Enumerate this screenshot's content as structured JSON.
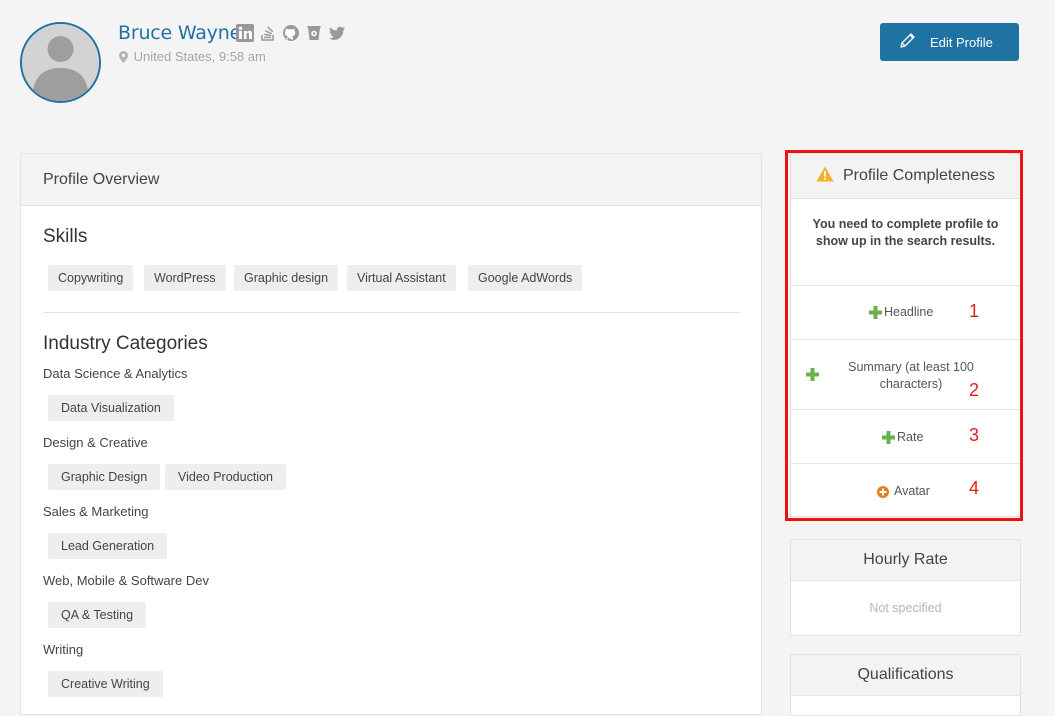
{
  "profile": {
    "name": "Bruce Wayne",
    "location": "United States, 9:58 am",
    "social_icons": [
      "linkedin-icon",
      "stackoverflow-icon",
      "github-icon",
      "coffee-icon",
      "twitter-icon"
    ],
    "edit_label": "Edit Profile"
  },
  "overview": {
    "title": "Profile Overview",
    "skills_title": "Skills",
    "skills": [
      "Copywriting",
      "WordPress",
      "Graphic design",
      "Virtual Assistant",
      "Google AdWords"
    ],
    "industry_title": "Industry Categories",
    "categories": [
      {
        "name": "Data Science & Analytics",
        "items": [
          "Data Visualization"
        ]
      },
      {
        "name": "Design & Creative",
        "items": [
          "Graphic Design",
          "Video Production"
        ]
      },
      {
        "name": "Sales & Marketing",
        "items": [
          "Lead Generation"
        ]
      },
      {
        "name": "Web, Mobile & Software Dev",
        "items": [
          "QA & Testing"
        ]
      },
      {
        "name": "Writing",
        "items": [
          "Creative Writing"
        ]
      }
    ]
  },
  "completeness": {
    "title": "Profile Completeness",
    "message": "You need to complete profile to show up in the search results.",
    "items": [
      {
        "label": "Headline",
        "number": "1",
        "icon": "plus-icon"
      },
      {
        "label": "Summary (at least 100 characters)",
        "number": "2",
        "icon": "plus-icon"
      },
      {
        "label": "Rate",
        "number": "3",
        "icon": "plus-icon"
      },
      {
        "label": "Avatar",
        "number": "4",
        "icon": "plus-circle-icon"
      }
    ]
  },
  "hourly_rate": {
    "title": "Hourly Rate",
    "value": "Not specified"
  },
  "qualifications": {
    "title": "Qualifications"
  },
  "colors": {
    "accent": "#1e73a3",
    "highlight": "#ee1111",
    "plus": "#6ab04c",
    "warning": "#f0b429"
  }
}
